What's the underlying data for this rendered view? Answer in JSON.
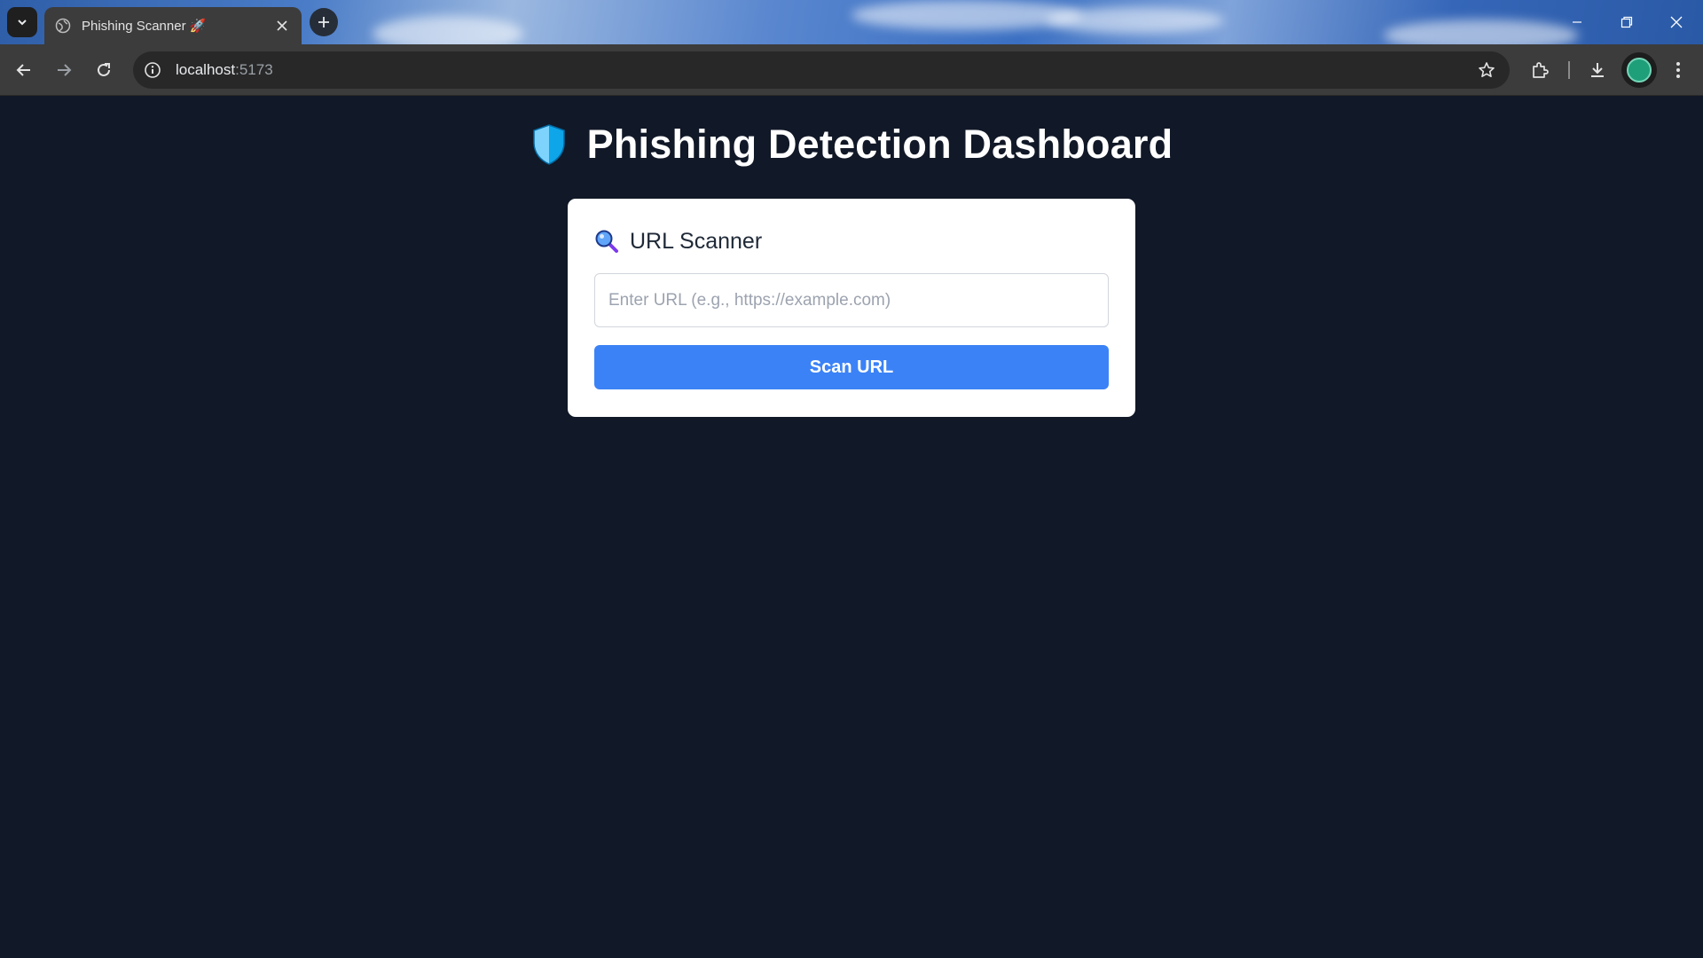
{
  "browser": {
    "tab_title": "Phishing Scanner 🚀",
    "address_host": "localhost",
    "address_port": ":5173"
  },
  "icons": {
    "tab_search": "chevron-down-icon",
    "tab_favicon": "globe-icon",
    "tab_close": "close-icon",
    "new_tab": "plus-icon",
    "minimize": "minimize-icon",
    "restore": "restore-icon",
    "window_close": "close-icon",
    "back": "arrow-left-icon",
    "forward": "arrow-right-icon",
    "reload": "reload-icon",
    "site_info": "info-icon",
    "bookmark": "star-icon",
    "extensions": "puzzle-icon",
    "downloads": "download-icon",
    "profile": "avatar-icon",
    "menu": "kebab-menu-icon",
    "heading": "shield-icon",
    "card": "magnifier-icon"
  },
  "dashboard": {
    "title": "Phishing Detection Dashboard",
    "scanner": {
      "title": "URL Scanner",
      "input_placeholder": "Enter URL (e.g., https://example.com)",
      "input_value": "",
      "button_label": "Scan URL"
    }
  },
  "colors": {
    "page_background": "#111827",
    "card_background": "#ffffff",
    "button_primary": "#3b82f6",
    "shield_light": "#7dd3fc",
    "shield_dark": "#0ea5e9"
  }
}
